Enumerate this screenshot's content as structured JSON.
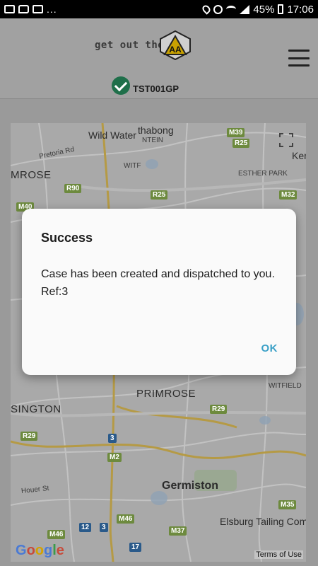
{
  "status_bar": {
    "left_icons": [
      "gmail-icon",
      "chat-icon",
      "photo-icon"
    ],
    "more": "...",
    "battery": "45%",
    "time": "17:06"
  },
  "header": {
    "tagline": "get out there",
    "logo_text": "AA",
    "registration": "TST001GP"
  },
  "map": {
    "labels": {
      "wild_water": "Wild Water",
      "thabong": "thabong",
      "ntein": "NTEIN",
      "witf": "WITF",
      "pretoria_rd": "Pretoria Rd",
      "mrose": "MROSE",
      "esther_park": "ESTHER PARK",
      "kem": "Ker",
      "witfield": "WITFIELD",
      "primrose": "PRIMROSE",
      "sington": "SINGTON",
      "houer_st": "Houer St",
      "germiston": "Germiston",
      "elsburg": "Elsburg Tailing Compl"
    },
    "shields": {
      "m39": "M39",
      "r25a": "R25",
      "r25b": "R25",
      "m32": "M32",
      "m40": "M40",
      "r90": "R90",
      "r29a": "R29",
      "r29b": "R29",
      "m2": "M2",
      "n3": "3",
      "m46": "M46",
      "m35": "M35",
      "m37": "M37",
      "n12": "12",
      "n3b": "3",
      "n17": "17",
      "m46b": "M46"
    },
    "google": "Google",
    "terms": "Terms of Use"
  },
  "dialog": {
    "title": "Success",
    "message_line1": "Case has been created and dispatched to you.",
    "message_line2": "Ref:3",
    "ok_label": "OK"
  },
  "colors": {
    "accent": "#3aa0c7",
    "check_green": "#1f6f4a",
    "aa_yellow": "#d4a800"
  }
}
